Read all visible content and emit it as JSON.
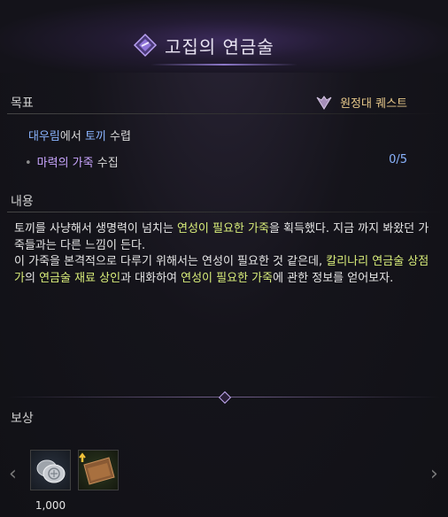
{
  "title": "고집의 연금술",
  "sections": {
    "objective_label": "목표",
    "content_label": "내용",
    "reward_label": "보상"
  },
  "quest_type": "원정대 퀘스트",
  "objective": {
    "location": "대우림",
    "mid": "에서 ",
    "target": "토끼",
    "action": " 수렵"
  },
  "task": {
    "item": "마력의 가죽",
    "action": " 수집",
    "progress": "0/5"
  },
  "description": {
    "p1": "토끼를 사냥해서 생명력이 넘치는 ",
    "h1": "연성이 필요한 가죽",
    "p2": "을 획득했다. 지금 까지 봐왔던 가죽들과는 다른 느낌이 든다.",
    "p3": "이 가죽을 본격적으로 다루기 위해서는 연성이 필요한 것 같은데, ",
    "h2": "칼리나리 연금술 상점가",
    "p4": "의 ",
    "h3": "연금술 재료 상인",
    "p5": "과 대화하여 ",
    "h4": "연성이 필요한 가죽",
    "p6": "에 관한 정보를 얻어보자."
  },
  "rewards": [
    {
      "icon": "silver-coin-icon",
      "count": "1,000"
    },
    {
      "icon": "leather-icon",
      "count": ""
    }
  ],
  "colors": {
    "accent_violet": "#c9a6ff",
    "highlight_green": "#d9ee7a",
    "highlight_blue": "#8ab4ff",
    "quest_gold": "#e8c98a"
  }
}
